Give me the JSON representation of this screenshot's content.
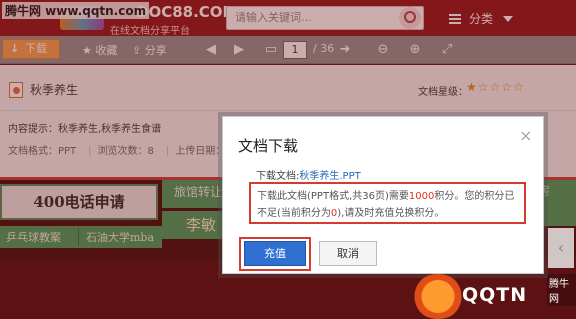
{
  "watermark_top": "腾牛网 www.qqtn.com",
  "header": {
    "brand": "DOC88.COM",
    "brand_sub": "在线文档分享平台",
    "search_placeholder": "请输入关键词…",
    "category_label": "分类"
  },
  "toolbar": {
    "download": "下载",
    "favorite": "收藏",
    "share": "分享",
    "page_current": "1",
    "page_total": "/ 36"
  },
  "doc": {
    "title": "秋季养生",
    "star_label": "文档星级：",
    "stars": "★☆☆☆☆",
    "prompt": "内容提示：秋季养生,秋季养生食谱",
    "format": "文档格式：PPT",
    "views": "浏览次数：8",
    "upload": "上传日期：201"
  },
  "ads": {
    "phone": "400电话申请",
    "hotel": "旅馆转让",
    "li": "李敏",
    "pingpong": "乒乓球教案",
    "univ": "石油大学mba",
    "right": "房"
  },
  "modal": {
    "title": "文档下载",
    "close": "×",
    "doc_label": "下载文档:",
    "doc_name": "秋季养生.PPT",
    "warn_pre": "下载此文档(PPT格式,共36页)需要",
    "warn_points": "1000",
    "warn_mid": "积分。您的积分已不足(当前积分为",
    "warn_zero": "0",
    "warn_post": "),请及时充值兑换积分。",
    "pay_button": "充值",
    "cancel_button": "取消"
  },
  "watermark_bottom": {
    "text": "QQTN",
    "tag": "腾牛网"
  }
}
